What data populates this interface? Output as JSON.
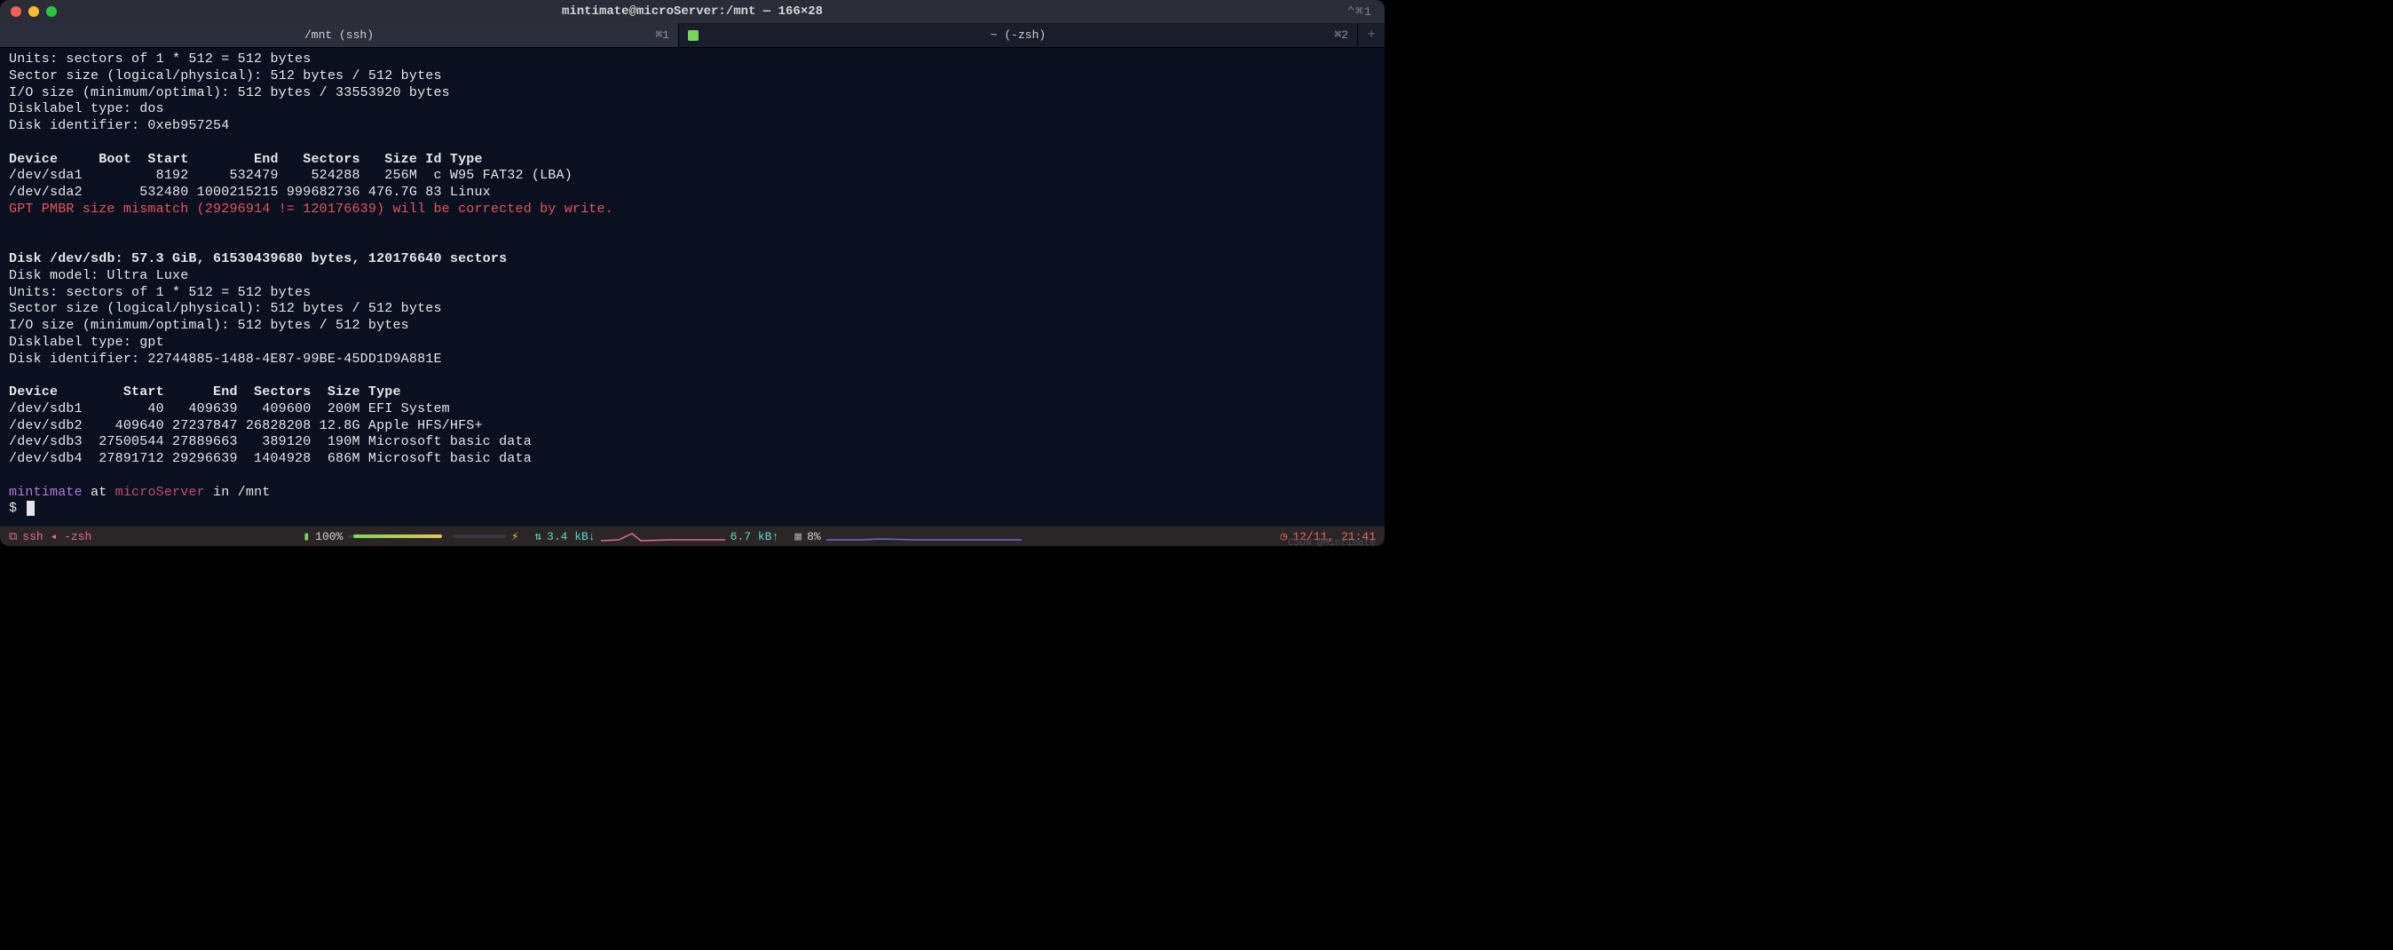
{
  "window": {
    "title": "mintimate@microServer:/mnt — 166×28",
    "right_hint": "⌃⌘1"
  },
  "tabs": [
    {
      "label": "/mnt (ssh)",
      "kbd": "⌘1",
      "active": true,
      "icon": false
    },
    {
      "label": "~ (-zsh)",
      "kbd": "⌘2",
      "active": false,
      "icon": true
    }
  ],
  "plus": "+",
  "output": {
    "sda_info": [
      "Units: sectors of 1 * 512 = 512 bytes",
      "Sector size (logical/physical): 512 bytes / 512 bytes",
      "I/O size (minimum/optimal): 512 bytes / 33553920 bytes",
      "Disklabel type: dos",
      "Disk identifier: 0xeb957254"
    ],
    "sda_header": "Device     Boot  Start        End   Sectors   Size Id Type",
    "sda_rows": [
      "/dev/sda1         8192     532479    524288   256M  c W95 FAT32 (LBA)",
      "/dev/sda2       532480 1000215215 999682736 476.7G 83 Linux"
    ],
    "gpt_warning": "GPT PMBR size mismatch (29296914 != 120176639) will be corrected by write.",
    "sdb_head": "Disk /dev/sdb: 57.3 GiB, 61530439680 bytes, 120176640 sectors",
    "sdb_info": [
      "Disk model: Ultra Luxe",
      "Units: sectors of 1 * 512 = 512 bytes",
      "Sector size (logical/physical): 512 bytes / 512 bytes",
      "I/O size (minimum/optimal): 512 bytes / 512 bytes",
      "Disklabel type: gpt",
      "Disk identifier: 22744885-1488-4E87-99BE-45DD1D9A881E"
    ],
    "sdb_header": "Device        Start      End  Sectors  Size Type",
    "sdb_rows": [
      "/dev/sdb1        40   409639   409600  200M EFI System",
      "/dev/sdb2    409640 27237847 26828208 12.8G Apple HFS/HFS+",
      "/dev/sdb3  27500544 27889663   389120  190M Microsoft basic data",
      "/dev/sdb4  27891712 29296639  1404928  686M Microsoft basic data"
    ],
    "prompt": {
      "user": "mintimate",
      "at": " at ",
      "host": "microServer",
      "in": " in ",
      "path": "/mnt",
      "symbol": "$ "
    }
  },
  "status": {
    "session": "ssh ◂ -zsh",
    "battery_pct": "100%",
    "net_down": "3.4 kB↓",
    "net_up": "6.7 kB↑",
    "cpu_pct": "8%",
    "clock": "12/11, 21:41"
  },
  "icons": {
    "link": "⚲",
    "battery": "▯",
    "net": "⇅",
    "bolt": "⚡",
    "cpu": "▦",
    "clock": "◷"
  },
  "watermark": "CSDN @Mintimate"
}
